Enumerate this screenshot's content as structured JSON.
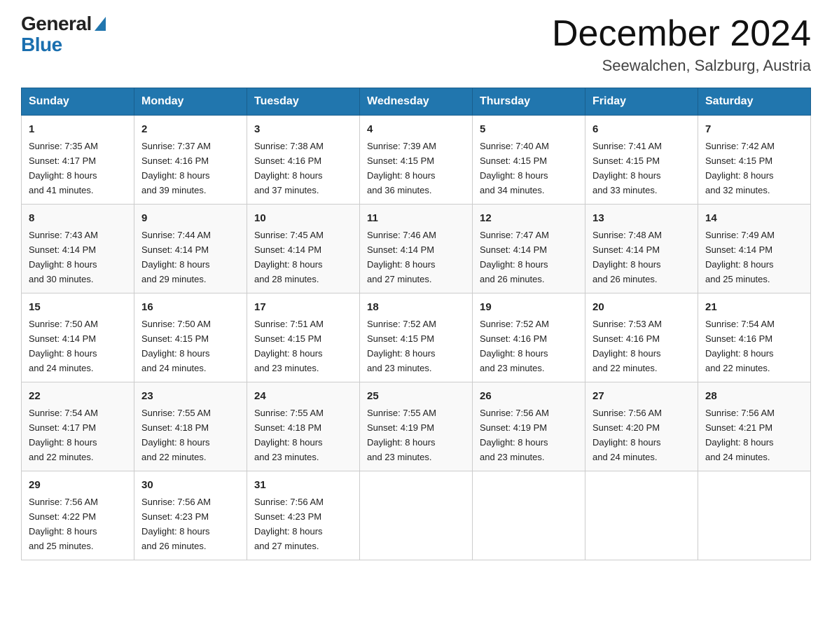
{
  "header": {
    "logo_general": "General",
    "logo_blue": "Blue",
    "month_title": "December 2024",
    "location": "Seewalchen, Salzburg, Austria"
  },
  "columns": [
    "Sunday",
    "Monday",
    "Tuesday",
    "Wednesday",
    "Thursday",
    "Friday",
    "Saturday"
  ],
  "weeks": [
    [
      {
        "day": "1",
        "sunrise": "Sunrise: 7:35 AM",
        "sunset": "Sunset: 4:17 PM",
        "daylight": "Daylight: 8 hours",
        "daylight2": "and 41 minutes."
      },
      {
        "day": "2",
        "sunrise": "Sunrise: 7:37 AM",
        "sunset": "Sunset: 4:16 PM",
        "daylight": "Daylight: 8 hours",
        "daylight2": "and 39 minutes."
      },
      {
        "day": "3",
        "sunrise": "Sunrise: 7:38 AM",
        "sunset": "Sunset: 4:16 PM",
        "daylight": "Daylight: 8 hours",
        "daylight2": "and 37 minutes."
      },
      {
        "day": "4",
        "sunrise": "Sunrise: 7:39 AM",
        "sunset": "Sunset: 4:15 PM",
        "daylight": "Daylight: 8 hours",
        "daylight2": "and 36 minutes."
      },
      {
        "day": "5",
        "sunrise": "Sunrise: 7:40 AM",
        "sunset": "Sunset: 4:15 PM",
        "daylight": "Daylight: 8 hours",
        "daylight2": "and 34 minutes."
      },
      {
        "day": "6",
        "sunrise": "Sunrise: 7:41 AM",
        "sunset": "Sunset: 4:15 PM",
        "daylight": "Daylight: 8 hours",
        "daylight2": "and 33 minutes."
      },
      {
        "day": "7",
        "sunrise": "Sunrise: 7:42 AM",
        "sunset": "Sunset: 4:15 PM",
        "daylight": "Daylight: 8 hours",
        "daylight2": "and 32 minutes."
      }
    ],
    [
      {
        "day": "8",
        "sunrise": "Sunrise: 7:43 AM",
        "sunset": "Sunset: 4:14 PM",
        "daylight": "Daylight: 8 hours",
        "daylight2": "and 30 minutes."
      },
      {
        "day": "9",
        "sunrise": "Sunrise: 7:44 AM",
        "sunset": "Sunset: 4:14 PM",
        "daylight": "Daylight: 8 hours",
        "daylight2": "and 29 minutes."
      },
      {
        "day": "10",
        "sunrise": "Sunrise: 7:45 AM",
        "sunset": "Sunset: 4:14 PM",
        "daylight": "Daylight: 8 hours",
        "daylight2": "and 28 minutes."
      },
      {
        "day": "11",
        "sunrise": "Sunrise: 7:46 AM",
        "sunset": "Sunset: 4:14 PM",
        "daylight": "Daylight: 8 hours",
        "daylight2": "and 27 minutes."
      },
      {
        "day": "12",
        "sunrise": "Sunrise: 7:47 AM",
        "sunset": "Sunset: 4:14 PM",
        "daylight": "Daylight: 8 hours",
        "daylight2": "and 26 minutes."
      },
      {
        "day": "13",
        "sunrise": "Sunrise: 7:48 AM",
        "sunset": "Sunset: 4:14 PM",
        "daylight": "Daylight: 8 hours",
        "daylight2": "and 26 minutes."
      },
      {
        "day": "14",
        "sunrise": "Sunrise: 7:49 AM",
        "sunset": "Sunset: 4:14 PM",
        "daylight": "Daylight: 8 hours",
        "daylight2": "and 25 minutes."
      }
    ],
    [
      {
        "day": "15",
        "sunrise": "Sunrise: 7:50 AM",
        "sunset": "Sunset: 4:14 PM",
        "daylight": "Daylight: 8 hours",
        "daylight2": "and 24 minutes."
      },
      {
        "day": "16",
        "sunrise": "Sunrise: 7:50 AM",
        "sunset": "Sunset: 4:15 PM",
        "daylight": "Daylight: 8 hours",
        "daylight2": "and 24 minutes."
      },
      {
        "day": "17",
        "sunrise": "Sunrise: 7:51 AM",
        "sunset": "Sunset: 4:15 PM",
        "daylight": "Daylight: 8 hours",
        "daylight2": "and 23 minutes."
      },
      {
        "day": "18",
        "sunrise": "Sunrise: 7:52 AM",
        "sunset": "Sunset: 4:15 PM",
        "daylight": "Daylight: 8 hours",
        "daylight2": "and 23 minutes."
      },
      {
        "day": "19",
        "sunrise": "Sunrise: 7:52 AM",
        "sunset": "Sunset: 4:16 PM",
        "daylight": "Daylight: 8 hours",
        "daylight2": "and 23 minutes."
      },
      {
        "day": "20",
        "sunrise": "Sunrise: 7:53 AM",
        "sunset": "Sunset: 4:16 PM",
        "daylight": "Daylight: 8 hours",
        "daylight2": "and 22 minutes."
      },
      {
        "day": "21",
        "sunrise": "Sunrise: 7:54 AM",
        "sunset": "Sunset: 4:16 PM",
        "daylight": "Daylight: 8 hours",
        "daylight2": "and 22 minutes."
      }
    ],
    [
      {
        "day": "22",
        "sunrise": "Sunrise: 7:54 AM",
        "sunset": "Sunset: 4:17 PM",
        "daylight": "Daylight: 8 hours",
        "daylight2": "and 22 minutes."
      },
      {
        "day": "23",
        "sunrise": "Sunrise: 7:55 AM",
        "sunset": "Sunset: 4:18 PM",
        "daylight": "Daylight: 8 hours",
        "daylight2": "and 22 minutes."
      },
      {
        "day": "24",
        "sunrise": "Sunrise: 7:55 AM",
        "sunset": "Sunset: 4:18 PM",
        "daylight": "Daylight: 8 hours",
        "daylight2": "and 23 minutes."
      },
      {
        "day": "25",
        "sunrise": "Sunrise: 7:55 AM",
        "sunset": "Sunset: 4:19 PM",
        "daylight": "Daylight: 8 hours",
        "daylight2": "and 23 minutes."
      },
      {
        "day": "26",
        "sunrise": "Sunrise: 7:56 AM",
        "sunset": "Sunset: 4:19 PM",
        "daylight": "Daylight: 8 hours",
        "daylight2": "and 23 minutes."
      },
      {
        "day": "27",
        "sunrise": "Sunrise: 7:56 AM",
        "sunset": "Sunset: 4:20 PM",
        "daylight": "Daylight: 8 hours",
        "daylight2": "and 24 minutes."
      },
      {
        "day": "28",
        "sunrise": "Sunrise: 7:56 AM",
        "sunset": "Sunset: 4:21 PM",
        "daylight": "Daylight: 8 hours",
        "daylight2": "and 24 minutes."
      }
    ],
    [
      {
        "day": "29",
        "sunrise": "Sunrise: 7:56 AM",
        "sunset": "Sunset: 4:22 PM",
        "daylight": "Daylight: 8 hours",
        "daylight2": "and 25 minutes."
      },
      {
        "day": "30",
        "sunrise": "Sunrise: 7:56 AM",
        "sunset": "Sunset: 4:23 PM",
        "daylight": "Daylight: 8 hours",
        "daylight2": "and 26 minutes."
      },
      {
        "day": "31",
        "sunrise": "Sunrise: 7:56 AM",
        "sunset": "Sunset: 4:23 PM",
        "daylight": "Daylight: 8 hours",
        "daylight2": "and 27 minutes."
      },
      null,
      null,
      null,
      null
    ]
  ]
}
